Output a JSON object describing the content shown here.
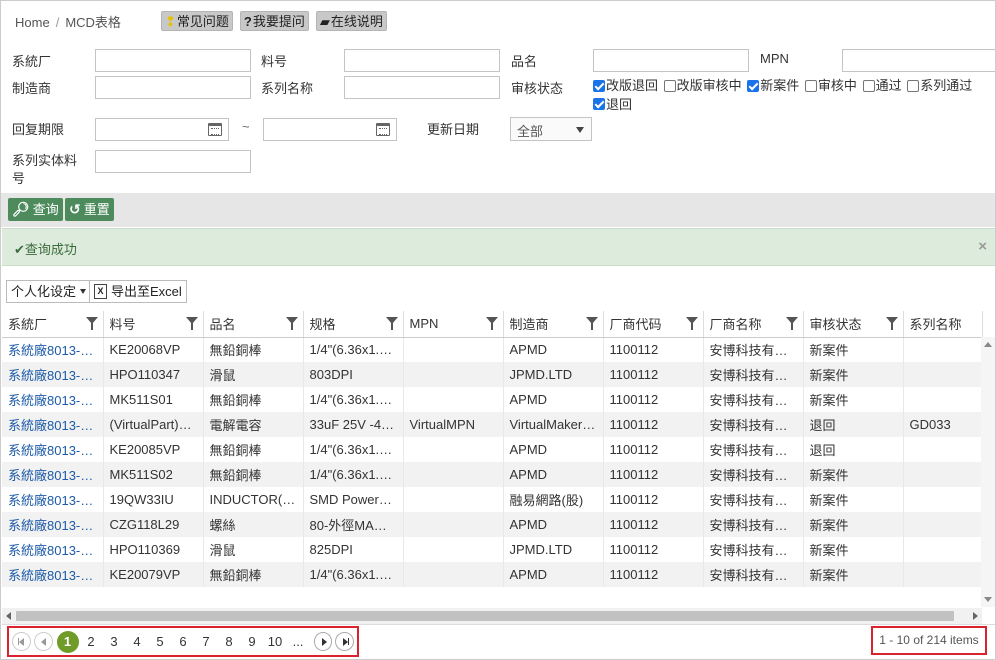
{
  "breadcrumb": {
    "home": "Home",
    "separator": "/",
    "current": "MCD表格"
  },
  "help": {
    "faq": "常见问题",
    "faq_icon": "lightbulb-icon",
    "ask": "我要提问",
    "ask_icon": "question-icon",
    "doc": "在线说明",
    "doc_icon": "book-icon"
  },
  "form": {
    "system_factory": "系統厂",
    "part_no": "料号",
    "product_name": "品名",
    "mpn": "MPN",
    "manufacturer": "制造商",
    "series_name": "系列名称",
    "review_status": "审核状态",
    "reply_deadline": "回复期限",
    "tilde": "~",
    "update_date": "更新日期",
    "update_date_value": "全部",
    "series_entity_part": "系列实体料号"
  },
  "status_checks": [
    {
      "label": "改版退回",
      "checked": true
    },
    {
      "label": "改版审核中",
      "checked": false
    },
    {
      "label": "新案件",
      "checked": true
    },
    {
      "label": "审核中",
      "checked": false
    },
    {
      "label": "通过",
      "checked": false
    },
    {
      "label": "系列通过",
      "checked": false
    },
    {
      "label": "退回",
      "checked": true
    }
  ],
  "actions": {
    "search": "查询",
    "reset": "重置"
  },
  "alert": {
    "message": "查询成功",
    "close": "×"
  },
  "toolbar": {
    "personalize": "个人化设定",
    "export": "导出至Excel"
  },
  "table": {
    "columns": [
      "系統厂",
      "料号",
      "品名",
      "规格",
      "MPN",
      "制造商",
      "厂商代码",
      "厂商名称",
      "审核状态",
      "系列名称"
    ],
    "rows": [
      [
        "系統廠8013-…",
        "KE20068VP",
        "無鉛銅棒",
        "1/4\"(6.36x1.…",
        "",
        "APMD",
        "1100112",
        "安博科技有…",
        "新案件",
        ""
      ],
      [
        "系統廠8013-…",
        "HPO110347",
        "滑鼠",
        "803DPI",
        "",
        "JPMD.LTD",
        "1100112",
        "安博科技有…",
        "新案件",
        ""
      ],
      [
        "系統廠8013-…",
        "MK511S01",
        "無鉛銅棒",
        "1/4\"(6.36x1.…",
        "",
        "APMD",
        "1100112",
        "安博科技有…",
        "新案件",
        ""
      ],
      [
        "系統廠8013-…",
        "(VirtualPart)…",
        "電解電容",
        "33uF 25V -4…",
        "VirtualMPN",
        "VirtualMaker…",
        "1100112",
        "安博科技有…",
        "退回",
        "GD033"
      ],
      [
        "系統廠8013-…",
        "KE20085VP",
        "無鉛銅棒",
        "1/4\"(6.36x1.…",
        "",
        "APMD",
        "1100112",
        "安博科技有…",
        "退回",
        ""
      ],
      [
        "系統廠8013-…",
        "MK511S02",
        "無鉛銅棒",
        "1/4\"(6.36x1.…",
        "",
        "APMD",
        "1100112",
        "安博科技有…",
        "新案件",
        ""
      ],
      [
        "系統廠8013-…",
        "19QW33IU",
        "INDUCTOR(…",
        "SMD Power…",
        "",
        "融易網路(股)",
        "1100112",
        "安博科技有…",
        "新案件",
        ""
      ],
      [
        "系統廠8013-…",
        "CZG118L29",
        "螺絲",
        "80-外徑MA…",
        "",
        "APMD",
        "1100112",
        "安博科技有…",
        "新案件",
        ""
      ],
      [
        "系統廠8013-…",
        "HPO110369",
        "滑鼠",
        "825DPI",
        "",
        "JPMD.LTD",
        "1100112",
        "安博科技有…",
        "新案件",
        ""
      ],
      [
        "系統廠8013-…",
        "KE20079VP",
        "無鉛銅棒",
        "1/4\"(6.36x1.…",
        "",
        "APMD",
        "1100112",
        "安博科技有…",
        "新案件",
        ""
      ]
    ]
  },
  "pager": {
    "pages": [
      "1",
      "2",
      "3",
      "4",
      "5",
      "6",
      "7",
      "8",
      "9",
      "10",
      "..."
    ],
    "current": "1",
    "info": "1 - 10 of 214 items"
  }
}
